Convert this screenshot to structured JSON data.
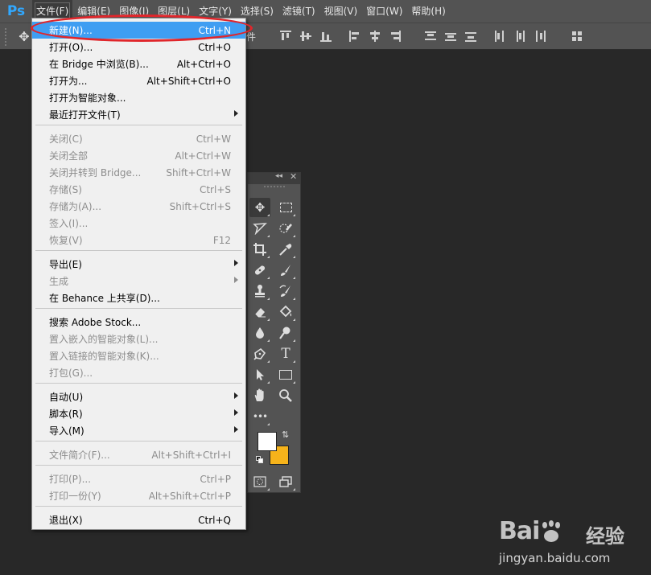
{
  "app": {
    "logo": "Ps"
  },
  "menubar": {
    "items": [
      "文件(F)",
      "编辑(E)",
      "图像(I)",
      "图层(L)",
      "文字(Y)",
      "选择(S)",
      "滤镜(T)",
      "视图(V)",
      "窗口(W)",
      "帮助(H)"
    ]
  },
  "options_bar": {
    "partial_text": "件"
  },
  "file_menu": {
    "items": [
      {
        "label": "新建(N)...",
        "shortcut": "Ctrl+N",
        "disabled": false,
        "highlighted": true
      },
      {
        "label": "打开(O)...",
        "shortcut": "Ctrl+O",
        "disabled": false
      },
      {
        "label": "在 Bridge 中浏览(B)...",
        "shortcut": "Alt+Ctrl+O",
        "disabled": false
      },
      {
        "label": "打开为...",
        "shortcut": "Alt+Shift+Ctrl+O",
        "disabled": false
      },
      {
        "label": "打开为智能对象...",
        "shortcut": "",
        "disabled": false
      },
      {
        "label": "最近打开文件(T)",
        "shortcut": "",
        "disabled": false,
        "submenu": true
      },
      {
        "label": "关闭(C)",
        "shortcut": "Ctrl+W",
        "disabled": true
      },
      {
        "label": "关闭全部",
        "shortcut": "Alt+Ctrl+W",
        "disabled": true
      },
      {
        "label": "关闭并转到 Bridge...",
        "shortcut": "Shift+Ctrl+W",
        "disabled": true
      },
      {
        "label": "存储(S)",
        "shortcut": "Ctrl+S",
        "disabled": true
      },
      {
        "label": "存储为(A)...",
        "shortcut": "Shift+Ctrl+S",
        "disabled": true
      },
      {
        "label": "签入(I)...",
        "shortcut": "",
        "disabled": true
      },
      {
        "label": "恢复(V)",
        "shortcut": "F12",
        "disabled": true
      },
      {
        "label": "导出(E)",
        "shortcut": "",
        "disabled": false,
        "submenu": true
      },
      {
        "label": "生成",
        "shortcut": "",
        "disabled": true,
        "submenu": true
      },
      {
        "label": "在 Behance 上共享(D)...",
        "shortcut": "",
        "disabled": false
      },
      {
        "label": "搜索 Adobe Stock...",
        "shortcut": "",
        "disabled": false
      },
      {
        "label": "置入嵌入的智能对象(L)...",
        "shortcut": "",
        "disabled": true
      },
      {
        "label": "置入链接的智能对象(K)...",
        "shortcut": "",
        "disabled": true
      },
      {
        "label": "打包(G)...",
        "shortcut": "",
        "disabled": true
      },
      {
        "label": "自动(U)",
        "shortcut": "",
        "disabled": false,
        "submenu": true
      },
      {
        "label": "脚本(R)",
        "shortcut": "",
        "disabled": false,
        "submenu": true
      },
      {
        "label": "导入(M)",
        "shortcut": "",
        "disabled": false,
        "submenu": true
      },
      {
        "label": "文件简介(F)...",
        "shortcut": "Alt+Shift+Ctrl+I",
        "disabled": true
      },
      {
        "label": "打印(P)...",
        "shortcut": "Ctrl+P",
        "disabled": true
      },
      {
        "label": "打印一份(Y)",
        "shortcut": "Alt+Shift+Ctrl+P",
        "disabled": true
      },
      {
        "label": "退出(X)",
        "shortcut": "Ctrl+Q",
        "disabled": false
      }
    ]
  },
  "tools_panel": {
    "tools": [
      "move-tool",
      "marquee-tool",
      "lasso-tool",
      "quick-selection-tool",
      "crop-tool",
      "eyedropper-tool",
      "healing-brush-tool",
      "brush-tool",
      "clone-stamp-tool",
      "history-brush-tool",
      "eraser-tool",
      "paint-bucket-tool",
      "blur-tool",
      "dodge-tool",
      "pen-tool",
      "type-tool",
      "path-selection-tool",
      "rectangle-tool",
      "hand-tool",
      "zoom-tool",
      "more-tools"
    ],
    "type_glyph": "T",
    "more_glyph": "•••",
    "foreground_color": "#ffffff",
    "background_color": "#f6b31b"
  },
  "watermark": {
    "logo_left": "Bai",
    "logo_right": "",
    "cn": "经验",
    "url": "jingyan.baidu.com"
  }
}
